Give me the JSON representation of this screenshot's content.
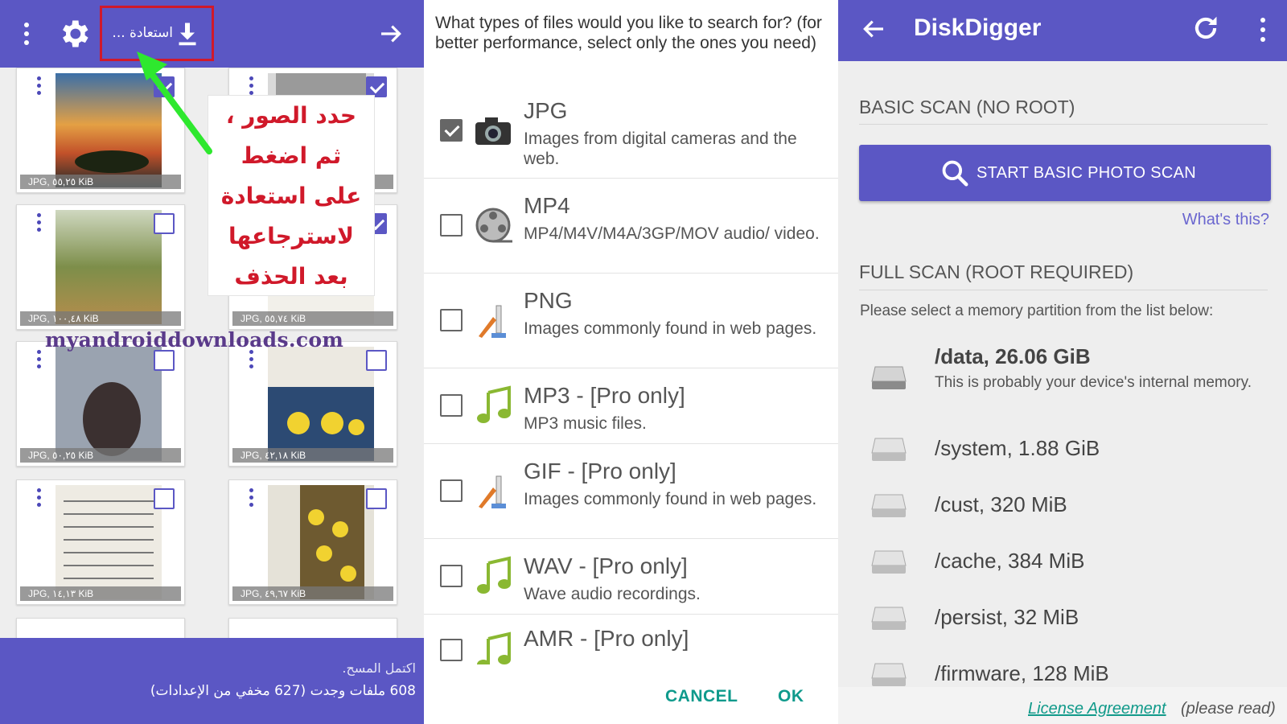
{
  "gallery": {
    "restore_label": "استعادة ...",
    "tiles": [
      {
        "caption": "JPG, ٥٥,٢٥ KiB",
        "checked": true
      },
      {
        "caption": "",
        "checked": true
      },
      {
        "caption": "JPG, ١٠٠,٤٨ KiB",
        "checked": false
      },
      {
        "caption": "JPG, ٥٥,٧٤ KiB",
        "checked": true
      },
      {
        "caption": "JPG, ٥٠,٢٥ KiB",
        "checked": false
      },
      {
        "caption": "JPG, ٤٢,١٨ KiB",
        "checked": false
      },
      {
        "caption": "JPG, ١٤,١٣ KiB",
        "checked": false
      },
      {
        "caption": "JPG, ٤٩,٦٧ KiB",
        "checked": false
      }
    ],
    "note_lines": [
      "حدد الصور ،",
      "ثم اضغط",
      "على استعادة",
      "لاسترجاعها",
      "بعد الحذف"
    ],
    "watermark": "myandroiddownloads.com",
    "footer_line1": "اكتمل المسح.",
    "footer_line2": "608 ملفات وجدت (627 مخفي من الإعدادات)",
    "colors": {
      "accent": "#5b57c4",
      "highlight": "#d0192a",
      "arrow": "#2ee82e"
    }
  },
  "filetypes": {
    "question": "What types of files would you like to search for? (for better performance, select only the ones you need)",
    "items": [
      {
        "title": "JPG",
        "desc": "Images from digital cameras and the web.",
        "checked": true,
        "icon": "camera-icon"
      },
      {
        "title": "MP4",
        "desc": "MP4/M4V/M4A/3GP/MOV audio/ video.",
        "checked": false,
        "icon": "film-reel-icon"
      },
      {
        "title": "PNG",
        "desc": "Images commonly found in web pages.",
        "checked": false,
        "icon": "paint-icon"
      },
      {
        "title": "MP3 - [Pro only]",
        "desc": "MP3 music files.",
        "checked": false,
        "icon": "music-note-icon"
      },
      {
        "title": "GIF - [Pro only]",
        "desc": "Images commonly found in web pages.",
        "checked": false,
        "icon": "paint-icon"
      },
      {
        "title": "WAV - [Pro only]",
        "desc": "Wave audio recordings.",
        "checked": false,
        "icon": "music-note-icon"
      },
      {
        "title": "AMR - [Pro only]",
        "desc": "",
        "checked": false,
        "icon": "music-note-icon"
      }
    ],
    "cancel_label": "CANCEL",
    "ok_label": "OK",
    "colors": {
      "button": "#0f9a8c"
    }
  },
  "diskdigger": {
    "title": "DiskDigger",
    "basic_scan_title": "BASIC SCAN (NO ROOT)",
    "scan_button_label": "START BASIC PHOTO SCAN",
    "whats_this": "What's this?",
    "full_scan_title": "FULL SCAN (ROOT REQUIRED)",
    "select_text": "Please select a memory partition from the list below:",
    "partitions": [
      {
        "name": "/data, 26.06 GiB",
        "desc": "This is probably your device's internal memory."
      },
      {
        "name": "/system, 1.88 GiB"
      },
      {
        "name": "/cust, 320 MiB"
      },
      {
        "name": "/cache, 384 MiB"
      },
      {
        "name": "/persist, 32 MiB"
      },
      {
        "name": "/firmware, 128 MiB"
      }
    ],
    "license_link": "License Agreement",
    "license_note": "(please read)",
    "colors": {
      "accent": "#5b57c4",
      "link": "#119a8a"
    }
  }
}
